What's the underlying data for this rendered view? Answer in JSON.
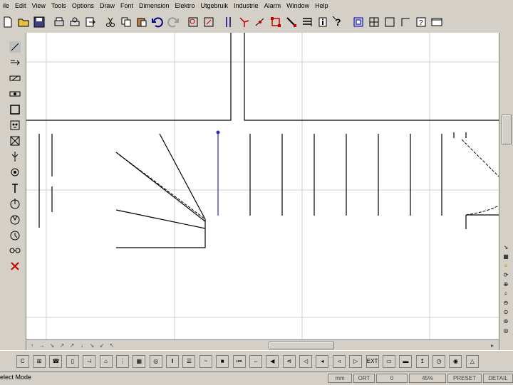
{
  "menu": [
    "ile",
    "Edit",
    "View",
    "Tools",
    "Options",
    "Draw",
    "Font",
    "Dimension",
    "Elektro",
    "Utgebruik",
    "Industrie",
    "Alarm",
    "Window",
    "Help"
  ],
  "top_icons": [
    "new-icon",
    "open-icon",
    "save-icon",
    "print-icon",
    "print-preview-icon",
    "export-icon",
    "cut-icon",
    "copy-icon",
    "paste-icon",
    "undo-icon",
    "redo-icon",
    "zoom-window-icon",
    "zoom-object-icon",
    "parallel-lines-icon",
    "snap-icon",
    "node-icon",
    "selection-box-icon",
    "pointer-icon",
    "list-icon",
    "info-icon",
    "help-icon",
    "layer-icon",
    "grid-icon",
    "rectangle-icon",
    "corner-icon",
    "help-question-icon",
    "window-icon"
  ],
  "left_tools": [
    "cable-tool",
    "lamp-tool",
    "switch-tool",
    "socket-tool",
    "box-tool",
    "outlet-tool",
    "cross-box-tool",
    "connector-tool",
    "gear-tool",
    "probe-tool",
    "clock-tool",
    "motor-tool",
    "timer-tool",
    "link-tool",
    "delete-tool"
  ],
  "bottom_icons": [
    "cable",
    "fuse",
    "phone",
    "door",
    "switch",
    "lamp",
    "keypad",
    "grid",
    "circle",
    "panel",
    "speaker-box",
    "curve",
    "stop",
    "skip-back",
    "transformer",
    "speaker",
    "speaker-alt",
    "speaker-b",
    "speaker-c",
    "horn",
    "amplifier",
    "exit-sign",
    "bus",
    "bar",
    "antenna",
    "clock",
    "alarm-bell",
    "flag"
  ],
  "exit_label": "EXT",
  "status": {
    "mode": "elect Mode",
    "unit": "mm",
    "ort": "ORT",
    "value": "0",
    "zoom": "45%",
    "preset": "PRESET",
    "detail": "DETAIL"
  }
}
